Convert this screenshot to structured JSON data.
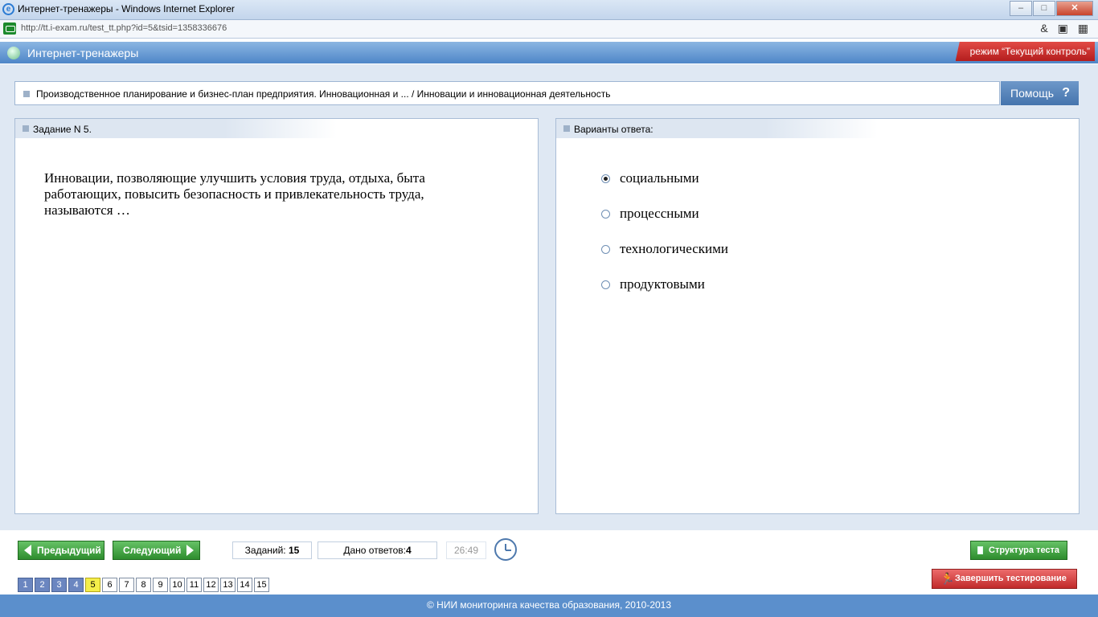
{
  "window": {
    "title": "Интернет-тренажеры - Windows Internet Explorer",
    "controls": {
      "minimize": "–",
      "maximize": "□",
      "close": "✕"
    }
  },
  "browser": {
    "url": "http://tt.i-exam.ru/test_tt.php?id=5&tsid=1358336676",
    "tools": "& ▣ ▦"
  },
  "app": {
    "title": "Интернет-тренажеры",
    "mode_badge": "режим “Текущий контроль”"
  },
  "breadcrumb": {
    "text": "Производственное планирование и бизнес-план предприятия. Инновационная и ... / Инновации и инновационная деятельность",
    "help_label": "Помощь",
    "help_icon": "?"
  },
  "task": {
    "header": "Задание N 5.",
    "question": "Инновации, позволяющие улучшить условия труда, отдыха, быта работающих, повысить безопасность и привлекательность труда, называются …"
  },
  "answers": {
    "header": "Варианты ответа:",
    "options": [
      {
        "label": "социальными",
        "selected": true
      },
      {
        "label": "процессными",
        "selected": false
      },
      {
        "label": "технологическими",
        "selected": false
      },
      {
        "label": "продуктовыми",
        "selected": false
      }
    ]
  },
  "controls": {
    "prev_label": "Предыдущий",
    "next_label": "Следующий",
    "tasks_label": "Заданий:",
    "tasks_count": "15",
    "answered_label": "Дано ответов:",
    "answered_count": "4",
    "timer": "26:49",
    "structure_label": "Структура теста",
    "finish_label": "Завершить тестирование"
  },
  "pages": [
    {
      "n": "1",
      "state": "answered"
    },
    {
      "n": "2",
      "state": "answered"
    },
    {
      "n": "3",
      "state": "answered"
    },
    {
      "n": "4",
      "state": "answered"
    },
    {
      "n": "5",
      "state": "current"
    },
    {
      "n": "6",
      "state": "pending"
    },
    {
      "n": "7",
      "state": "pending"
    },
    {
      "n": "8",
      "state": "pending"
    },
    {
      "n": "9",
      "state": "pending"
    },
    {
      "n": "10",
      "state": "pending"
    },
    {
      "n": "11",
      "state": "pending"
    },
    {
      "n": "12",
      "state": "pending"
    },
    {
      "n": "13",
      "state": "pending"
    },
    {
      "n": "14",
      "state": "pending"
    },
    {
      "n": "15",
      "state": "pending"
    }
  ],
  "footer": "© НИИ мониторинга качества образования, 2010-2013",
  "colors": {
    "header_blue": "#5b8fcc",
    "button_green": "#2e8d2e",
    "finish_red": "#c12b2b",
    "current_page": "#f5ee4a",
    "answered_page": "#6b86c0"
  }
}
